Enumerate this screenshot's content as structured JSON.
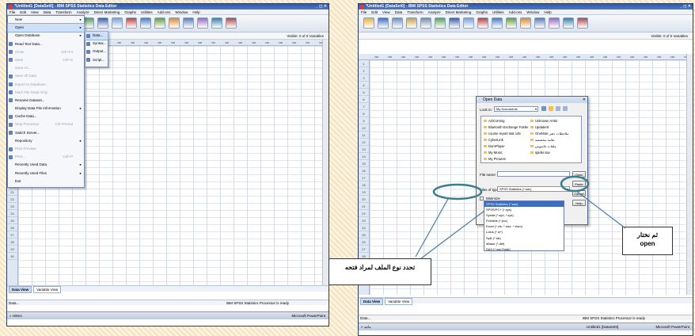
{
  "common": {
    "menu": [
      "File",
      "Edit",
      "View",
      "Data",
      "Transform",
      "Analyze",
      "Direct Marketing",
      "Graphs",
      "Utilities",
      "Add-ons",
      "Window",
      "Help"
    ],
    "visible_vars": "Visible: 0 of 0 Variables",
    "var_col": "var",
    "tab_data": "Data View",
    "tab_var": "Variable View",
    "status_ready": "IBM SPSS Statistics Processor is ready",
    "colors": {
      "title": "#2f5ba8",
      "highlight": "#3e6bc4",
      "annotation_ellipse": "#3b7d8c",
      "page_texture": "#f3e3bf"
    }
  },
  "left": {
    "title": "*Untitled1 [DataSet0] - IBM SPSS Statistics Data Editor",
    "file_menu": [
      {
        "label": "New",
        "arrow": "▸",
        "state": "normal",
        "icon": ""
      },
      {
        "label": "Open",
        "arrow": "▸",
        "state": "hl",
        "icon": ""
      },
      {
        "label": "Open Database",
        "arrow": "▸",
        "state": "normal",
        "icon": ""
      },
      {
        "label": "Read Text Data...",
        "arrow": "",
        "state": "normal",
        "icon": "text-data-icon"
      },
      {
        "label": "Close",
        "shortcut": "Ctrl+F4",
        "state": "dis",
        "icon": "close-icon"
      },
      {
        "label": "Save",
        "shortcut": "Ctrl+S",
        "state": "dis",
        "icon": "save-icon"
      },
      {
        "label": "Save As...",
        "state": "dis",
        "icon": ""
      },
      {
        "label": "Save All Data",
        "state": "dis",
        "icon": "save-all-icon"
      },
      {
        "label": "Export to Database...",
        "state": "dis",
        "icon": "export-icon"
      },
      {
        "label": "Mark File Read Only",
        "state": "dis",
        "icon": "lock-icon"
      },
      {
        "label": "Rename Dataset...",
        "state": "normal",
        "icon": "rename-icon"
      },
      {
        "label": "Display Data File Information",
        "arrow": "▸",
        "state": "normal",
        "icon": ""
      },
      {
        "label": "Cache Data...",
        "state": "normal",
        "icon": "cache-icon"
      },
      {
        "label": "Stop Processor",
        "shortcut": "Ctrl+Period",
        "state": "dis",
        "icon": "stop-icon"
      },
      {
        "label": "Switch Server...",
        "state": "normal",
        "icon": "server-icon"
      },
      {
        "label": "Repository",
        "arrow": "▸",
        "state": "normal",
        "icon": ""
      },
      {
        "label": "Print Preview",
        "state": "dis",
        "icon": "preview-icon"
      },
      {
        "label": "Print...",
        "shortcut": "Ctrl+P",
        "state": "dis",
        "icon": "print-icon"
      },
      {
        "label": "Recently Used Data",
        "arrow": "▸",
        "state": "normal",
        "icon": ""
      },
      {
        "label": "Recently Used Files",
        "arrow": "▸",
        "state": "normal",
        "icon": ""
      },
      {
        "label": "Exit",
        "state": "normal",
        "icon": ""
      }
    ],
    "open_submenu": [
      "Data...",
      "Syntax...",
      "Output...",
      "Script..."
    ],
    "status_left": "Data...",
    "taskbar_left": "» HSSA",
    "taskbar_right": "Microsoft PowerPoint"
  },
  "right": {
    "title": "*Untitled1 [DataSet0] - IBM SPSS Statistics Data Editor",
    "rows": [
      "1",
      "2",
      "3",
      "4",
      "5",
      "6",
      "7",
      "8",
      "9",
      "10",
      "11",
      "12",
      "13",
      "14",
      "15",
      "16",
      "17",
      "18",
      "19",
      "20",
      "21",
      "22",
      "23",
      "24",
      "25",
      "26",
      "27",
      "28",
      "29",
      "30"
    ],
    "dialog": {
      "title": "Open Data",
      "look_in_label": "Look in:",
      "look_in_value": "My Documents",
      "files_col1": [
        "AOComing",
        "Bluetooth Exchange Folder",
        "course report stat 145",
        "CyberLink",
        "DumPlayer",
        "My Music",
        "My Pictures"
      ],
      "files_col2": [
        "Unknown Artist",
        "Updater5",
        "OneNote ملاحظات دفتر",
        "علامة مخصصة",
        "ملفات جاسوس",
        "spider.sav"
      ],
      "filename_label": "File name:",
      "filetype_label": "Files of type:",
      "filetype_value": "SPSS Statistics (*.sav)",
      "minimize_label": "Minimize",
      "buttons": [
        "Open",
        "Paste",
        "Cancel",
        "Help"
      ],
      "type_options": [
        "SPSS Statistics (*.sav)",
        "SPSS/PC+ (*.sys)",
        "Systat (*.syd, *.sys)",
        "Portable (*.por)",
        "Excel (*.xls, *.xlsx, *.xlsm)",
        "Lotus (*.w*)",
        "Sylk (*.slk)",
        "dBase (*.dbf)",
        "SAS (*.sas7bdat)"
      ]
    },
    "status_left": "Data...",
    "taskbar_left": "» ماجد",
    "taskbar_item1": "Untitled1 [DataSet0]",
    "taskbar_right": "Microsoft PowerPoint"
  },
  "annotations": {
    "left_note": "تحدد نوع الملف لمراد فتحه",
    "right_note_line1": "ثم نختار",
    "right_note_line2": "open"
  }
}
